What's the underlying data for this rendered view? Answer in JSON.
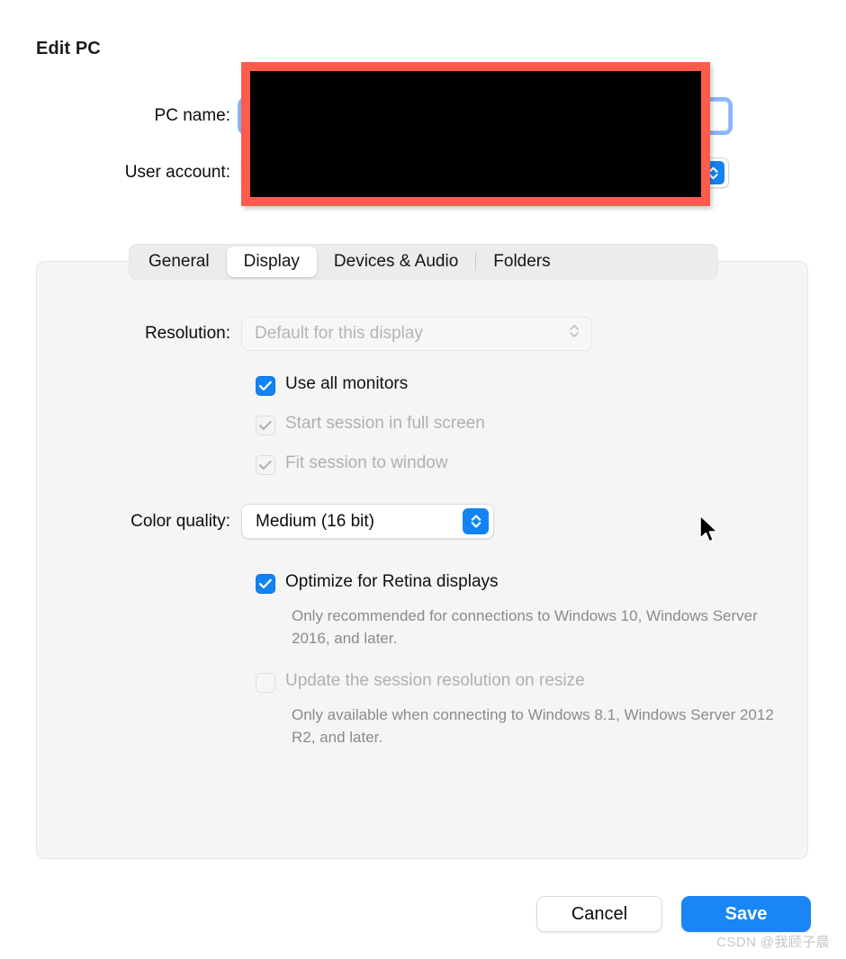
{
  "dialog": {
    "title": "Edit PC"
  },
  "form": {
    "pc_name": {
      "label": "PC name:",
      "value": "",
      "placeholder": ""
    },
    "user_account": {
      "label": "User account:",
      "value": ""
    }
  },
  "redaction": {
    "note": "black-redaction-box",
    "border_color": "#fc5c4c",
    "fill_color": "#000000"
  },
  "tabs": [
    {
      "label": "General",
      "selected": false
    },
    {
      "label": "Display",
      "selected": true
    },
    {
      "label": "Devices & Audio",
      "selected": false
    },
    {
      "label": "Folders",
      "selected": false
    }
  ],
  "display": {
    "resolution": {
      "label": "Resolution:",
      "value": "Default for this display",
      "enabled": false
    },
    "use_all_monitors": {
      "label": "Use all monitors",
      "checked": true,
      "enabled": true
    },
    "start_full_screen": {
      "label": "Start session in full screen",
      "checked": true,
      "enabled": false
    },
    "fit_session_to_window": {
      "label": "Fit session to window",
      "checked": true,
      "enabled": false
    },
    "color_quality": {
      "label": "Color quality:",
      "value": "Medium (16 bit)"
    },
    "optimize_retina": {
      "label": "Optimize for Retina displays",
      "checked": true,
      "enabled": true,
      "help": "Only recommended for connections to Windows 10, Windows Server 2016, and later."
    },
    "update_resolution_on_resize": {
      "label": "Update the session resolution on resize",
      "checked": false,
      "enabled": false,
      "help": "Only available when connecting to Windows 8.1, Windows Server 2012 R2, and later."
    }
  },
  "footer": {
    "cancel_label": "Cancel",
    "save_label": "Save"
  },
  "watermark": {
    "text": "CSDN @我顾子晨"
  },
  "colors": {
    "accent": "#1283f2",
    "save_button": "#1a85f5",
    "redaction_border": "#fc5c4c",
    "panel_bg": "#f5f5f5",
    "tabbar_bg": "#ececec"
  }
}
